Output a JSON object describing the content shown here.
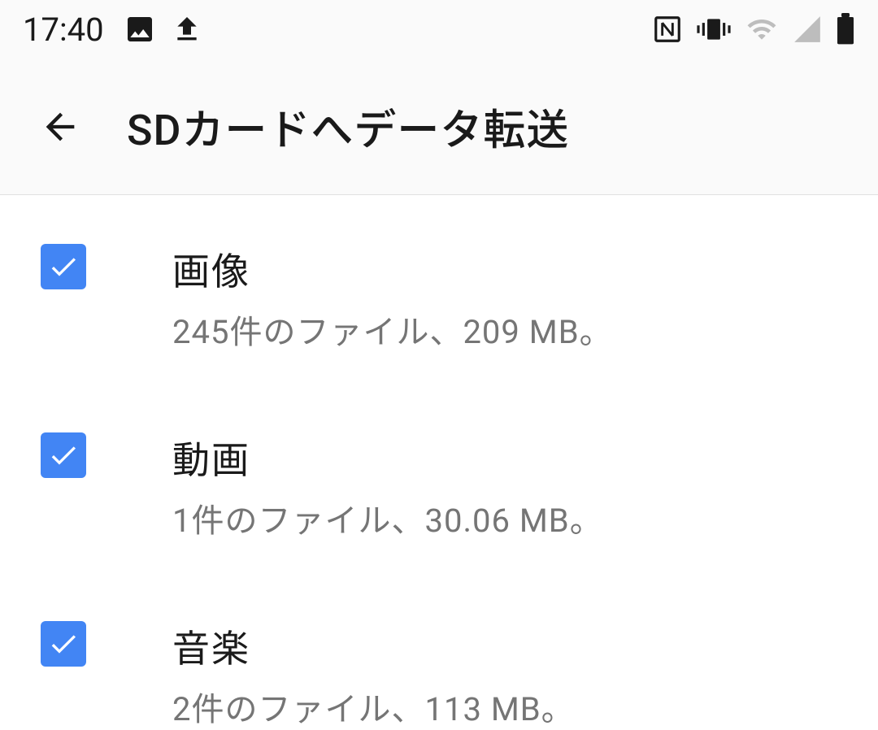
{
  "status_bar": {
    "time": "17:40"
  },
  "header": {
    "title": "SDカードへデータ転送"
  },
  "items": [
    {
      "title": "画像",
      "subtitle": "245件のファイル、209 MB。",
      "checked": true
    },
    {
      "title": "動画",
      "subtitle": "1件のファイル、30.06 MB。",
      "checked": true
    },
    {
      "title": "音楽",
      "subtitle": "2件のファイル、113 MB。",
      "checked": true
    }
  ]
}
